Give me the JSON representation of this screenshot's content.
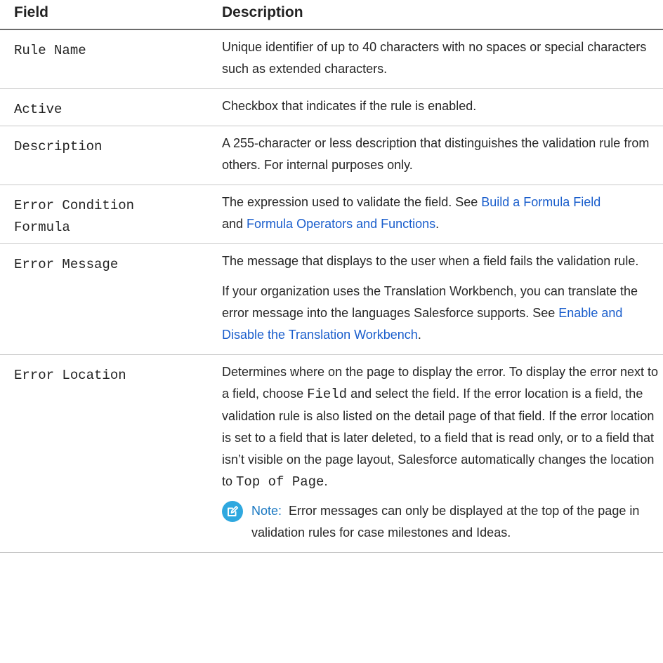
{
  "table": {
    "headers": {
      "field": "Field",
      "description": "Description"
    },
    "rows": [
      {
        "field": "Rule Name",
        "description": "Unique identifier of up to 40 characters with no spaces or special characters such as extended characters."
      },
      {
        "field": "Active",
        "description": "Checkbox that indicates if the rule is enabled."
      },
      {
        "field": "Description",
        "description": "A 255-character or less description that distinguishes the validation rule from others. For internal purposes only."
      },
      {
        "field_line1": "Error Condition",
        "field_line2": "Formula",
        "desc_text1": "The expression used to validate the field. See ",
        "link1": "Build a Formula Field",
        "desc_and": "and ",
        "link2": "Formula Operators and Functions",
        "desc_end": "."
      },
      {
        "field": "Error Message",
        "desc_p1": "The message that displays to the user when a field fails the validation rule.",
        "desc_p2_text": "If your organization uses the Translation Workbench, you can translate the error message into the languages Salesforce supports. See ",
        "desc_p2_link": "Enable and Disable the Translation Workbench",
        "desc_p2_end": "."
      },
      {
        "field": "Error Location",
        "desc_a": "Determines where on the page to display the error. To display the error next to a field, choose ",
        "desc_code1": "Field",
        "desc_b": " and select the field. If the error location is a field, the validation rule is also listed on the detail page of that field. If the error location is set to a field that is later deleted, to a field that is read only, or to a field that isn’t visible on the page layout, Salesforce automatically changes the location to ",
        "desc_code2": "Top of Page",
        "desc_c": ".",
        "note_label": "Note:",
        "note_text": "Error messages can only be displayed at the top of the page in validation rules for case milestones and Ideas."
      }
    ]
  },
  "colors": {
    "link": "#1a5ecc",
    "note_icon": "#2fa8df",
    "note_label": "#1a78c2"
  },
  "icons": {
    "note": "note-edit-icon"
  }
}
